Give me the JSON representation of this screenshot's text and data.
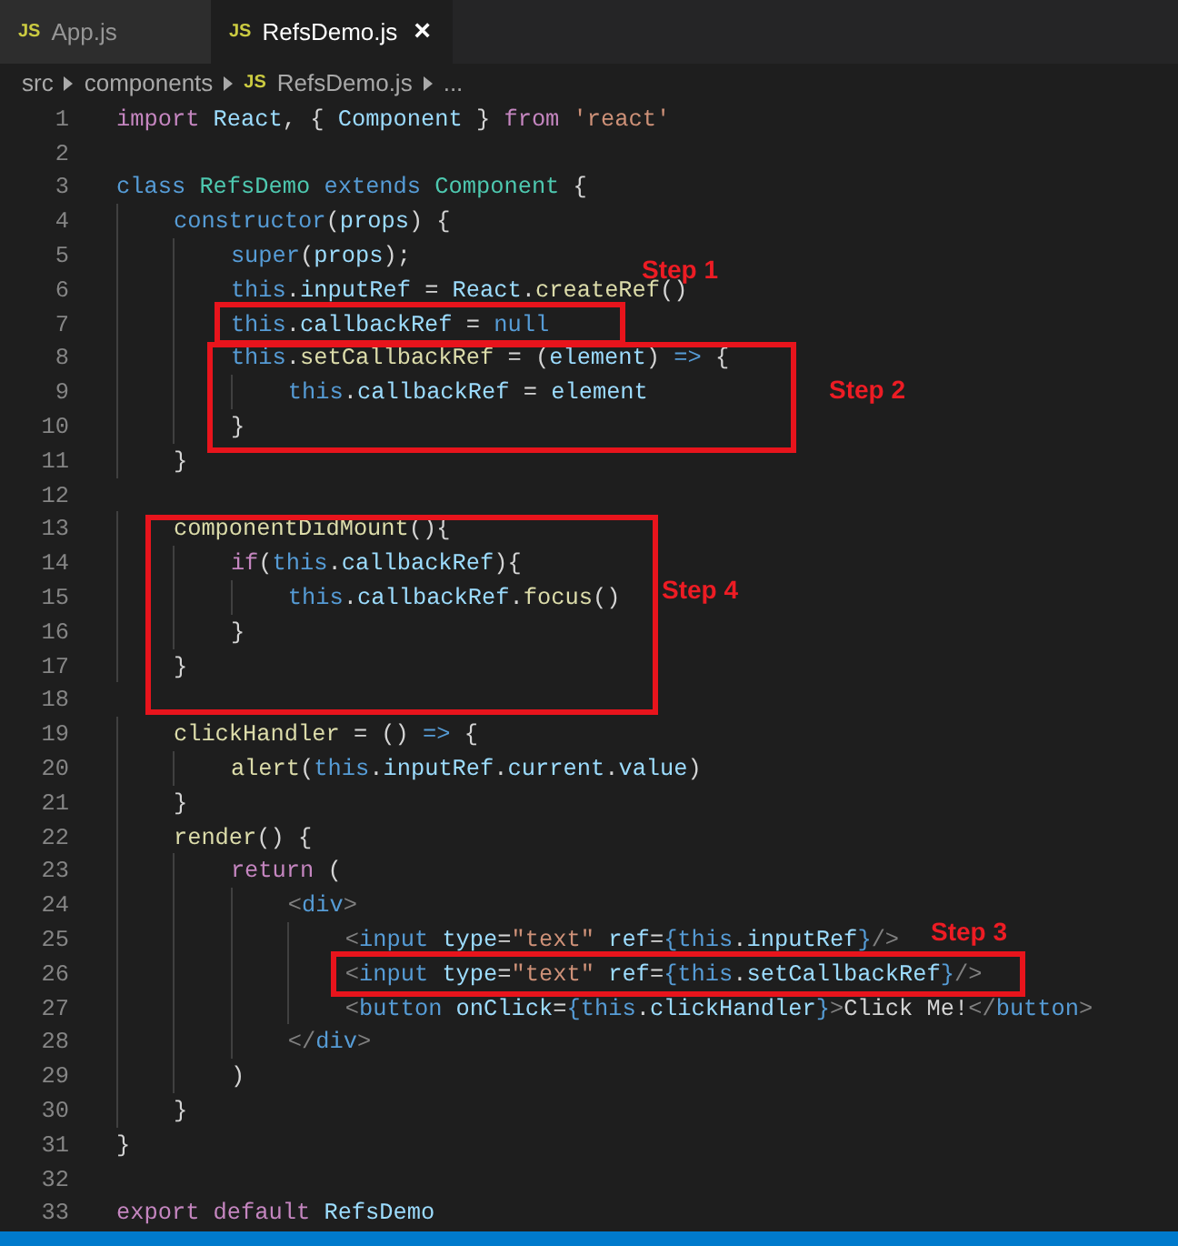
{
  "tabs": [
    {
      "icon": "JS",
      "label": "App.js",
      "selected": false
    },
    {
      "icon": "JS",
      "label": "RefsDemo.js",
      "selected": true,
      "close": "×"
    }
  ],
  "breadcrumb": [
    {
      "kind": "text",
      "text": "src"
    },
    {
      "kind": "text",
      "text": "components"
    },
    {
      "kind": "file",
      "icon": "JS",
      "text": "RefsDemo.js"
    },
    {
      "kind": "text",
      "text": "..."
    }
  ],
  "lines": [
    {
      "number": "1",
      "tokens": [
        {
          "kind": "ctl",
          "text": "import"
        },
        {
          "kind": "var",
          "text": " React"
        },
        {
          "kind": "punc",
          "text": ", { "
        },
        {
          "kind": "var",
          "text": "Component"
        },
        {
          "kind": "punc",
          "text": " } "
        },
        {
          "kind": "ctl",
          "text": "from"
        },
        {
          "kind": "str",
          "text": " 'react'"
        }
      ]
    },
    {
      "number": "2"
    },
    {
      "number": "3",
      "tokens": [
        {
          "kind": "kw",
          "text": "class"
        },
        {
          "kind": "type",
          "text": " RefsDemo"
        },
        {
          "kind": "kw",
          "text": " extends"
        },
        {
          "kind": "type",
          "text": " Component"
        },
        {
          "kind": "punc",
          "text": " {"
        }
      ]
    },
    {
      "number": "4",
      "tokens": [
        {
          "kind": "kw",
          "text": "    constructor"
        },
        {
          "kind": "punc",
          "text": "("
        },
        {
          "kind": "var",
          "text": "props"
        },
        {
          "kind": "punc",
          "text": ") {"
        }
      ]
    },
    {
      "number": "5",
      "tokens": [
        {
          "kind": "kw",
          "text": "        super"
        },
        {
          "kind": "punc",
          "text": "("
        },
        {
          "kind": "var",
          "text": "props"
        },
        {
          "kind": "punc",
          "text": ");"
        }
      ]
    },
    {
      "number": "6",
      "tokens": [
        {
          "kind": "kw",
          "text": "        this"
        },
        {
          "kind": "punc",
          "text": "."
        },
        {
          "kind": "var",
          "text": "inputRef"
        },
        {
          "kind": "punc",
          "text": " = "
        },
        {
          "kind": "var",
          "text": "React"
        },
        {
          "kind": "punc",
          "text": "."
        },
        {
          "kind": "fn",
          "text": "createRef"
        },
        {
          "kind": "punc",
          "text": "()"
        }
      ]
    },
    {
      "number": "7",
      "tokens": [
        {
          "kind": "kw",
          "text": "        this"
        },
        {
          "kind": "punc",
          "text": "."
        },
        {
          "kind": "var",
          "text": "callbackRef"
        },
        {
          "kind": "punc",
          "text": " = "
        },
        {
          "kind": "kw",
          "text": "null"
        }
      ]
    },
    {
      "number": "8",
      "tokens": [
        {
          "kind": "kw",
          "text": "        this"
        },
        {
          "kind": "punc",
          "text": "."
        },
        {
          "kind": "fn",
          "text": "setCallbackRef"
        },
        {
          "kind": "punc",
          "text": " = ("
        },
        {
          "kind": "var",
          "text": "element"
        },
        {
          "kind": "punc",
          "text": ") "
        },
        {
          "kind": "kw",
          "text": "=>"
        },
        {
          "kind": "punc",
          "text": " {"
        }
      ]
    },
    {
      "number": "9",
      "tokens": [
        {
          "kind": "kw",
          "text": "            this"
        },
        {
          "kind": "punc",
          "text": "."
        },
        {
          "kind": "var",
          "text": "callbackRef"
        },
        {
          "kind": "punc",
          "text": " = "
        },
        {
          "kind": "var",
          "text": "element"
        }
      ]
    },
    {
      "number": "10",
      "tokens": [
        {
          "kind": "punc",
          "text": "        }"
        }
      ]
    },
    {
      "number": "11",
      "tokens": [
        {
          "kind": "punc",
          "text": "    }"
        }
      ]
    },
    {
      "number": "12"
    },
    {
      "number": "13",
      "tokens": [
        {
          "kind": "fn",
          "text": "    componentDidMount"
        },
        {
          "kind": "punc",
          "text": "(){"
        }
      ]
    },
    {
      "number": "14",
      "tokens": [
        {
          "kind": "ctl",
          "text": "        if"
        },
        {
          "kind": "punc",
          "text": "("
        },
        {
          "kind": "kw",
          "text": "this"
        },
        {
          "kind": "punc",
          "text": "."
        },
        {
          "kind": "var",
          "text": "callbackRef"
        },
        {
          "kind": "punc",
          "text": "){"
        }
      ]
    },
    {
      "number": "15",
      "tokens": [
        {
          "kind": "kw",
          "text": "            this"
        },
        {
          "kind": "punc",
          "text": "."
        },
        {
          "kind": "var",
          "text": "callbackRef"
        },
        {
          "kind": "punc",
          "text": "."
        },
        {
          "kind": "fn",
          "text": "focus"
        },
        {
          "kind": "punc",
          "text": "()"
        }
      ]
    },
    {
      "number": "16",
      "tokens": [
        {
          "kind": "punc",
          "text": "        }"
        }
      ]
    },
    {
      "number": "17",
      "tokens": [
        {
          "kind": "punc",
          "text": "    }"
        }
      ]
    },
    {
      "number": "18"
    },
    {
      "number": "19",
      "tokens": [
        {
          "kind": "fn",
          "text": "    clickHandler"
        },
        {
          "kind": "punc",
          "text": " = () "
        },
        {
          "kind": "kw",
          "text": "=>"
        },
        {
          "kind": "punc",
          "text": " {"
        }
      ]
    },
    {
      "number": "20",
      "tokens": [
        {
          "kind": "fn",
          "text": "        alert"
        },
        {
          "kind": "punc",
          "text": "("
        },
        {
          "kind": "kw",
          "text": "this"
        },
        {
          "kind": "punc",
          "text": "."
        },
        {
          "kind": "var",
          "text": "inputRef"
        },
        {
          "kind": "punc",
          "text": "."
        },
        {
          "kind": "var",
          "text": "current"
        },
        {
          "kind": "punc",
          "text": "."
        },
        {
          "kind": "var",
          "text": "value"
        },
        {
          "kind": "punc",
          "text": ")"
        }
      ]
    },
    {
      "number": "21",
      "tokens": [
        {
          "kind": "punc",
          "text": "    }"
        }
      ]
    },
    {
      "number": "22",
      "tokens": [
        {
          "kind": "fn",
          "text": "    render"
        },
        {
          "kind": "punc",
          "text": "() {"
        }
      ]
    },
    {
      "number": "23",
      "tokens": [
        {
          "kind": "ctl",
          "text": "        return"
        },
        {
          "kind": "punc",
          "text": " ("
        }
      ]
    },
    {
      "number": "24",
      "tokens": [
        {
          "kind": "tagp",
          "text": "            <"
        },
        {
          "kind": "kw",
          "text": "div"
        },
        {
          "kind": "tagp",
          "text": ">"
        }
      ]
    },
    {
      "number": "25",
      "tokens": [
        {
          "kind": "tagp",
          "text": "                <"
        },
        {
          "kind": "kw",
          "text": "input"
        },
        {
          "kind": "var",
          "text": " type"
        },
        {
          "kind": "punc",
          "text": "="
        },
        {
          "kind": "str",
          "text": "\"text\""
        },
        {
          "kind": "var",
          "text": " ref"
        },
        {
          "kind": "punc",
          "text": "="
        },
        {
          "kind": "kw",
          "text": "{this"
        },
        {
          "kind": "punc",
          "text": "."
        },
        {
          "kind": "var",
          "text": "inputRef"
        },
        {
          "kind": "kw",
          "text": "}"
        },
        {
          "kind": "tagp",
          "text": "/>"
        }
      ]
    },
    {
      "number": "26",
      "tokens": [
        {
          "kind": "tagp",
          "text": "                <"
        },
        {
          "kind": "kw",
          "text": "input"
        },
        {
          "kind": "var",
          "text": " type"
        },
        {
          "kind": "punc",
          "text": "="
        },
        {
          "kind": "str",
          "text": "\"text\""
        },
        {
          "kind": "var",
          "text": " ref"
        },
        {
          "kind": "punc",
          "text": "="
        },
        {
          "kind": "kw",
          "text": "{this"
        },
        {
          "kind": "punc",
          "text": "."
        },
        {
          "kind": "var",
          "text": "setCallbackRef"
        },
        {
          "kind": "kw",
          "text": "}"
        },
        {
          "kind": "tagp",
          "text": "/>"
        }
      ]
    },
    {
      "number": "27",
      "tokens": [
        {
          "kind": "tagp",
          "text": "                <"
        },
        {
          "kind": "kw",
          "text": "button"
        },
        {
          "kind": "var",
          "text": " onClick"
        },
        {
          "kind": "punc",
          "text": "="
        },
        {
          "kind": "kw",
          "text": "{this"
        },
        {
          "kind": "punc",
          "text": "."
        },
        {
          "kind": "var",
          "text": "clickHandler"
        },
        {
          "kind": "kw",
          "text": "}"
        },
        {
          "kind": "tagp",
          "text": ">"
        },
        {
          "kind": "punc",
          "text": "Click Me!"
        },
        {
          "kind": "tagp",
          "text": "</"
        },
        {
          "kind": "kw",
          "text": "button"
        },
        {
          "kind": "tagp",
          "text": ">"
        }
      ]
    },
    {
      "number": "28",
      "tokens": [
        {
          "kind": "tagp",
          "text": "            </"
        },
        {
          "kind": "kw",
          "text": "div"
        },
        {
          "kind": "tagp",
          "text": ">"
        }
      ]
    },
    {
      "number": "29",
      "tokens": [
        {
          "kind": "punc",
          "text": "        )"
        }
      ]
    },
    {
      "number": "30",
      "tokens": [
        {
          "kind": "punc",
          "text": "    }"
        }
      ]
    },
    {
      "number": "31",
      "tokens": [
        {
          "kind": "punc",
          "text": "}"
        }
      ]
    },
    {
      "number": "32"
    },
    {
      "number": "33",
      "tokens": [
        {
          "kind": "ctl",
          "text": "export default"
        },
        {
          "kind": "var",
          "text": " RefsDemo"
        }
      ]
    }
  ],
  "annotations": [
    {
      "label": "Step 1"
    },
    {
      "label": "Step 2"
    },
    {
      "label": "Step 4"
    },
    {
      "label": "Step 3"
    }
  ]
}
